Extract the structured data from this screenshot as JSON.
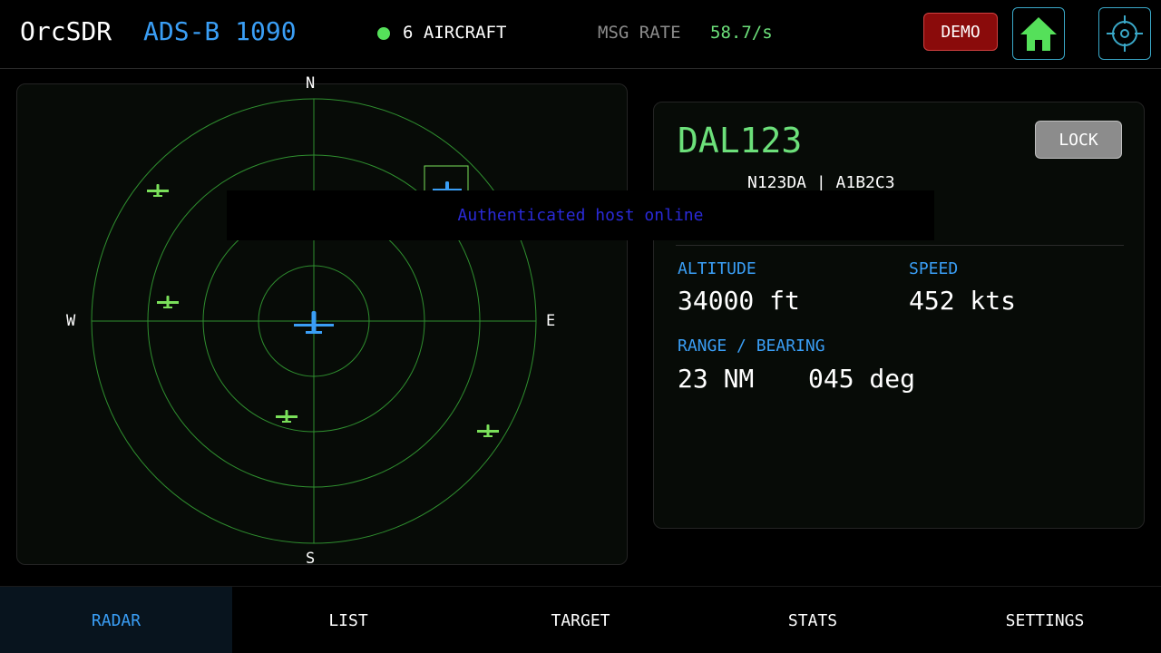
{
  "header": {
    "app_name": "OrcSDR",
    "mode": "ADS-B 1090",
    "aircraft_count": "6 AIRCRAFT",
    "msg_rate_label": "MSG RATE",
    "msg_rate_value": "58.7/s",
    "demo_label": "DEMO",
    "home_icon": "home-icon",
    "target_icon": "crosshair-icon"
  },
  "radar": {
    "compass": {
      "north": "N",
      "south": "S",
      "east": "E",
      "west": "W"
    },
    "ring_count": 4,
    "selected_aircraft_color": "#3a9ef5",
    "other_aircraft_color": "#7ae05a",
    "grid_color": "#2f8f2f"
  },
  "toast": {
    "message": "Authenticated host online"
  },
  "target": {
    "callsign": "DAL123",
    "lock_label": "LOCK",
    "registration_line": "N123DA | A1B2C3",
    "altitude_label": "ALTITUDE",
    "altitude_value": "34000 ft",
    "speed_label": "SPEED",
    "speed_value": "452 kts",
    "range_bearing_label": "RANGE / BEARING",
    "range_value": "23 NM",
    "bearing_value": "045 deg"
  },
  "nav": {
    "tabs": [
      {
        "label": "RADAR",
        "active": true
      },
      {
        "label": "LIST",
        "active": false
      },
      {
        "label": "TARGET",
        "active": false
      },
      {
        "label": "STATS",
        "active": false
      },
      {
        "label": "SETTINGS",
        "active": false
      }
    ]
  },
  "colors": {
    "accent_blue": "#3a9ef5",
    "accent_green": "#6ce07a",
    "demo_red": "#8a0b0b",
    "home_green": "#55e05a"
  }
}
